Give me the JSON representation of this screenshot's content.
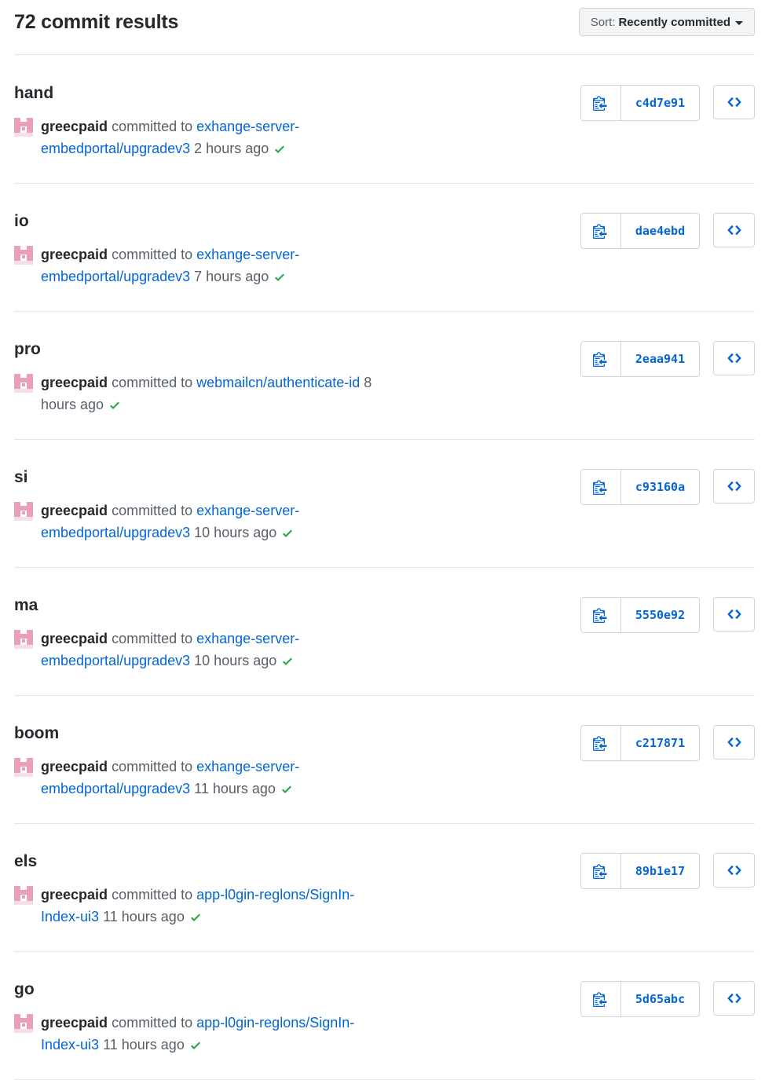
{
  "header": {
    "results_title": "72 commit results",
    "sort_label": "Sort:",
    "sort_value": "Recently committed"
  },
  "colors": {
    "link": "#0366d6",
    "check": "#28a745",
    "avatar": "#e99fba",
    "border": "#e1e4e8"
  },
  "icons": {
    "copy": "clippy-icon",
    "browse": "code-icon",
    "status": "check-icon",
    "avatar": "identicon-avatar"
  },
  "commits": [
    {
      "message": "hand",
      "author": "greecpaid",
      "committed_to": "committed to",
      "repo_line1": "exhange-server-",
      "repo_line2": "embedportal/upgradev3",
      "time": "2 hours ago",
      "sha": "c4d7e91"
    },
    {
      "message": "io",
      "author": "greecpaid",
      "committed_to": "committed to",
      "repo_line1": "exhange-server-",
      "repo_line2": "embedportal/upgradev3",
      "time": "7 hours ago",
      "sha": "dae4ebd"
    },
    {
      "message": "pro",
      "author": "greecpaid",
      "committed_to": "committed to",
      "repo_line1": "webmailcn/authenticate-id",
      "repo_line2": "",
      "time": "8 hours ago",
      "sha": "2eaa941"
    },
    {
      "message": "si",
      "author": "greecpaid",
      "committed_to": "committed to",
      "repo_line1": "exhange-server-",
      "repo_line2": "embedportal/upgradev3",
      "time": "10 hours ago",
      "sha": "c93160a"
    },
    {
      "message": "ma",
      "author": "greecpaid",
      "committed_to": "committed to",
      "repo_line1": "exhange-server-",
      "repo_line2": "embedportal/upgradev3",
      "time": "10 hours ago",
      "sha": "5550e92"
    },
    {
      "message": "boom",
      "author": "greecpaid",
      "committed_to": "committed to",
      "repo_line1": "exhange-server-",
      "repo_line2": "embedportal/upgradev3",
      "time": "11 hours ago",
      "sha": "c217871"
    },
    {
      "message": "els",
      "author": "greecpaid",
      "committed_to": "committed to",
      "repo_line1": "app-l0gin-reglons/SignIn-",
      "repo_line2": "Index-ui3",
      "time": "11 hours ago",
      "sha": "89b1e17"
    },
    {
      "message": "go",
      "author": "greecpaid",
      "committed_to": "committed to",
      "repo_line1": "app-l0gin-reglons/SignIn-",
      "repo_line2": "Index-ui3",
      "time": "11 hours ago",
      "sha": "5d65abc"
    }
  ]
}
